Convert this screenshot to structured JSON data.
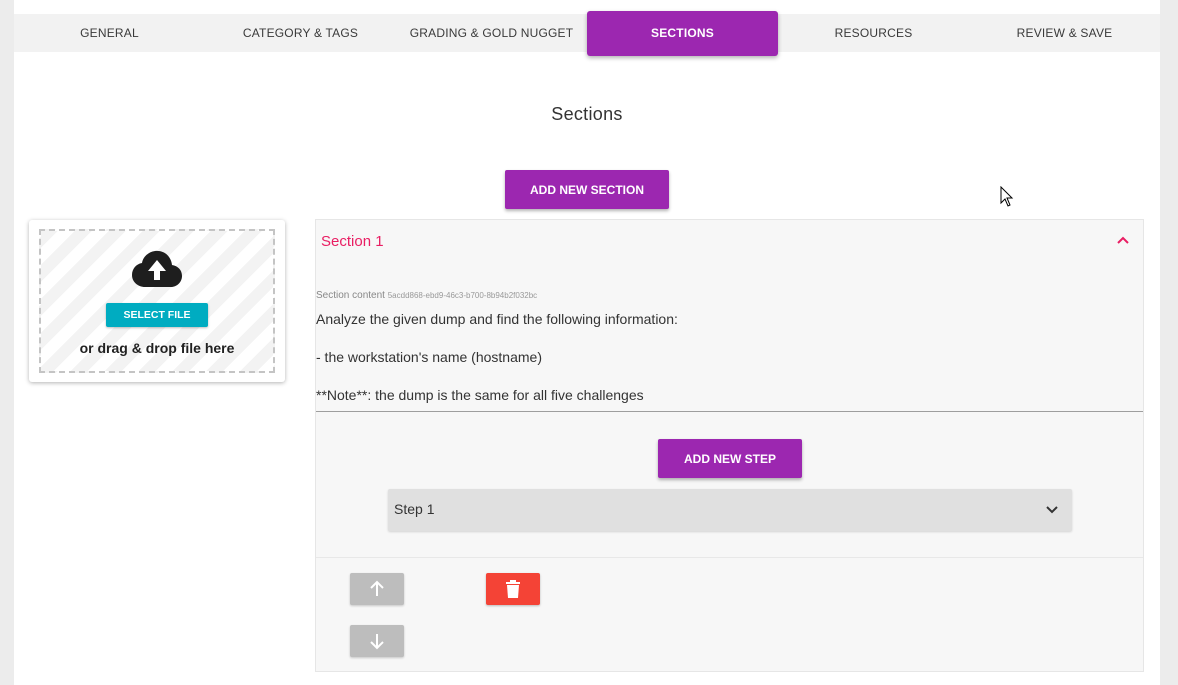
{
  "tabs": [
    {
      "label": "GENERAL",
      "active": false
    },
    {
      "label": "CATEGORY & TAGS",
      "active": false
    },
    {
      "label": "GRADING & GOLD NUGGET",
      "active": false
    },
    {
      "label": "SECTIONS",
      "active": true
    },
    {
      "label": "RESOURCES",
      "active": false
    },
    {
      "label": "REVIEW & SAVE",
      "active": false
    }
  ],
  "page_title": "Sections",
  "add_section_label": "ADD NEW SECTION",
  "upload": {
    "icon": "cloud-upload-icon",
    "select_file_label": "SELECT FILE",
    "drop_text": "or drag & drop file here"
  },
  "section": {
    "title": "Section 1",
    "expanded": true,
    "content_label": "Section content",
    "content_id": "5acdd868-ebd9-46c3-b700-8b94b2f032bc",
    "content_lines": [
      "Analyze the given dump and find the following information:",
      "- the workstation's name (hostname)",
      "**Note**: the dump is the same for all five challenges"
    ],
    "add_step_label": "ADD NEW STEP",
    "steps": [
      {
        "label": "Step 1",
        "expanded": false
      }
    ],
    "actions": {
      "move_up_icon": "arrow-up-icon",
      "move_down_icon": "arrow-down-icon",
      "delete_icon": "trash-icon"
    }
  },
  "colors": {
    "accent": "#9c27b0",
    "section_title": "#e91e63",
    "select_file": "#00acc1",
    "delete": "#f44336",
    "disabled": "#bdbdbd"
  }
}
